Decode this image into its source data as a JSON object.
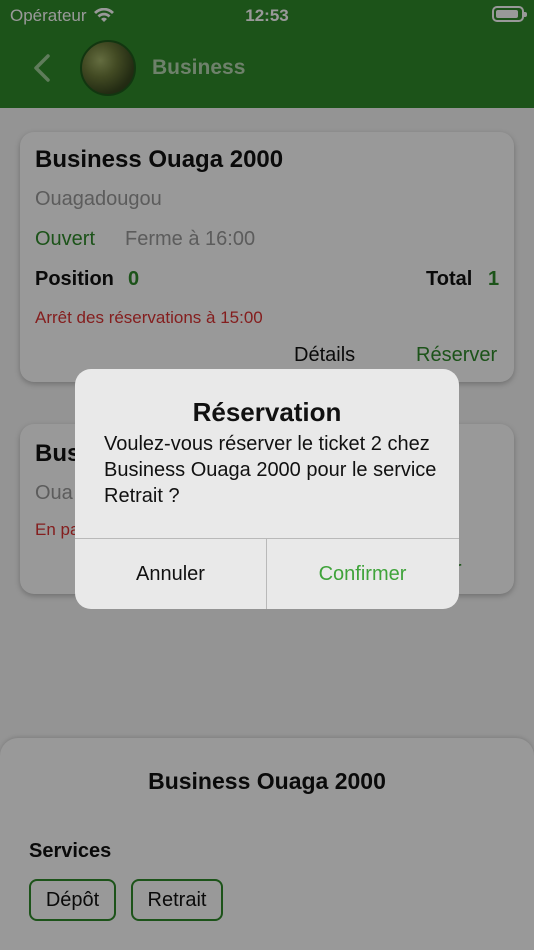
{
  "status_bar": {
    "carrier": "Opérateur",
    "time": "12:53"
  },
  "nav": {
    "title": "Business"
  },
  "cards": [
    {
      "name": "Business Ouaga 2000",
      "city": "Ouagadougou",
      "open_status": "Ouvert",
      "close_info": "Ferme à 16:00",
      "position_label": "Position",
      "position_value": "0",
      "total_label": "Total",
      "total_value": "1",
      "stop_info": "Arrêt des réservations à 15:00",
      "details_label": "Détails",
      "reserve_label": "Réserver"
    },
    {
      "name_visible": "Bus",
      "city_visible": "Oua",
      "status_visible": "En pa",
      "reserve_visible": "erver"
    }
  ],
  "sheet": {
    "title": "Business Ouaga 2000",
    "services_label": "Services",
    "services": [
      "Dépôt",
      "Retrait"
    ]
  },
  "alert": {
    "title": "Réservation",
    "message": "Voulez-vous réserver le ticket 2 chez Business Ouaga 2000 pour le service Retrait ?",
    "cancel_label": "Annuler",
    "confirm_label": "Confirmer"
  },
  "colors": {
    "primary": "#2f8a2a",
    "confirm": "#3fa33a",
    "warning": "#d33333"
  }
}
